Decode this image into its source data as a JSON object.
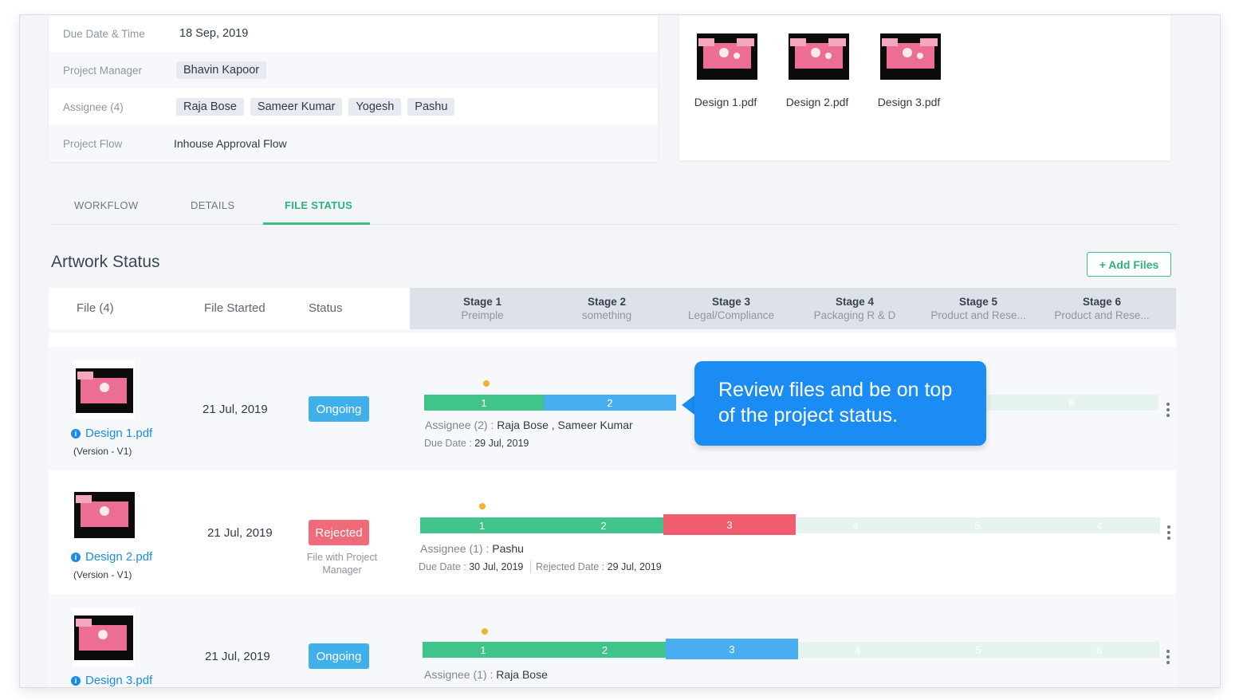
{
  "info": {
    "due_label": "Due Date & Time",
    "due_value": "18 Sep, 2019",
    "pm_label": "Project Manager",
    "pm_value": "Bhavin Kapoor",
    "assignee_label": "Assignee (4)",
    "assignees": [
      "Raja Bose",
      "Sameer Kumar",
      "Yogesh",
      "Pashu"
    ],
    "flow_label": "Project Flow",
    "flow_value": "Inhouse Approval Flow"
  },
  "attached_files": [
    "Design 1.pdf",
    "Design 2.pdf",
    "Design 3.pdf"
  ],
  "tabs": [
    {
      "label": "WORKFLOW",
      "active": false
    },
    {
      "label": "DETAILS",
      "active": false
    },
    {
      "label": "FILE STATUS",
      "active": true
    }
  ],
  "section_title": "Artwork Status",
  "add_files_label": "+ Add Files",
  "table": {
    "col_file": "File (4)",
    "col_started": "File Started",
    "col_status": "Status",
    "stages": [
      {
        "title": "Stage 1",
        "sub": "Preimple"
      },
      {
        "title": "Stage 2",
        "sub": "something"
      },
      {
        "title": "Stage 3",
        "sub": "Legal/Compliance"
      },
      {
        "title": "Stage 4",
        "sub": "Packaging R & D"
      },
      {
        "title": "Stage 5",
        "sub": "Product and Rese..."
      },
      {
        "title": "Stage 6",
        "sub": "Product and Rese..."
      }
    ]
  },
  "rows": [
    {
      "file": "Design 1.pdf",
      "version": "(Version - V1)",
      "started": "21 Jul, 2019",
      "status": "Ongoing",
      "progress_labels": [
        "1",
        "2",
        "6"
      ],
      "assignee_prefix": "Assignee (2) : ",
      "assignee_names": "Raja Bose , Sameer Kumar",
      "due_prefix": "Due Date : ",
      "due": "29 Jul, 2019"
    },
    {
      "file": "Design 2.pdf",
      "version": "(Version - V1)",
      "started": "21 Jul, 2019",
      "status": "Rejected",
      "status_sub": "File with Project Manager",
      "progress_labels": [
        "1",
        "2",
        "3",
        "4",
        "5",
        "4"
      ],
      "assignee_prefix": "Assignee (1) : ",
      "assignee_names": "Pashu",
      "due_prefix": "Due Date : ",
      "due": "30 Jul, 2019",
      "rejected_prefix": "Rejected Date : ",
      "rejected": "29 Jul, 2019"
    },
    {
      "file": "Design 3.pdf",
      "started": "21 Jul, 2019",
      "status": "Ongoing",
      "progress_labels": [
        "1",
        "2",
        "3",
        "4",
        "5",
        "6"
      ],
      "assignee_prefix": "Assignee (1) : ",
      "assignee_names": "Raja Bose"
    }
  ],
  "callout": "Review files and be on top of the project status.",
  "colors": {
    "accent_green": "#3bbf86",
    "progress_green": "#41c48a",
    "progress_blue": "#49aef0",
    "progress_red": "#ef5d6e",
    "ongoing": "#40b0ea",
    "rejected": "#f06b7a",
    "callout": "#1a8cf3",
    "link": "#1c8ce0"
  }
}
